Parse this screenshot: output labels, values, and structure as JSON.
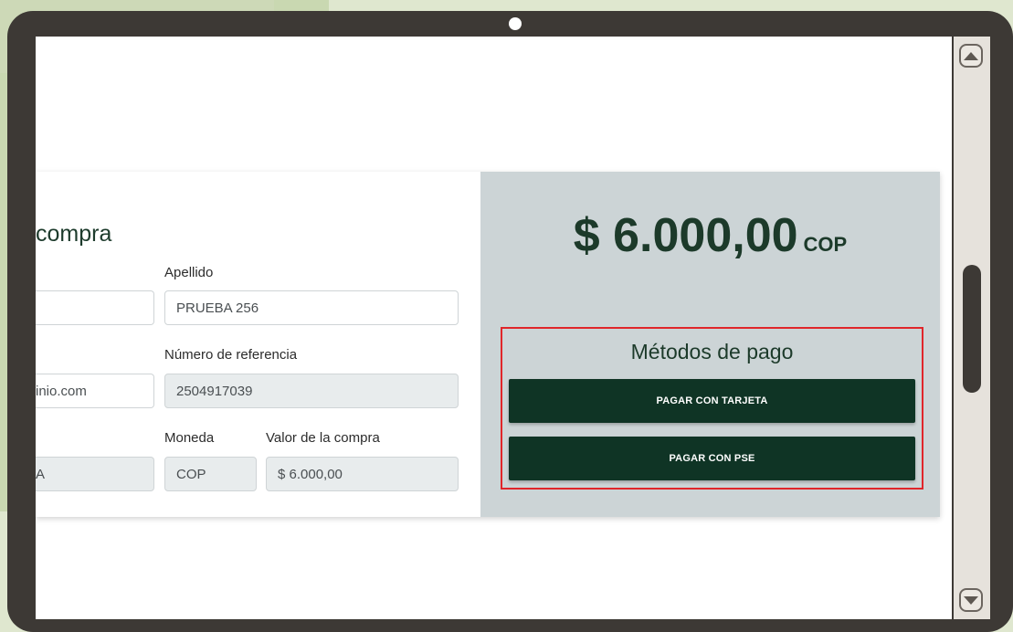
{
  "form": {
    "title": "compra",
    "labels": {
      "apellido": "Apellido",
      "numero_referencia": "Número de referencia",
      "moneda": "Moneda",
      "valor_compra": "Valor de la compra"
    },
    "fields": {
      "nombre": "",
      "apellido": "PRUEBA 256",
      "email": "inio.com",
      "numero_referencia": "2504917039",
      "tipo_documento": "A",
      "moneda": "COP",
      "valor_compra": "$ 6.000,00"
    }
  },
  "summary": {
    "amount": "$ 6.000,00",
    "currency": "COP"
  },
  "payment_methods": {
    "title": "Métodos de pago",
    "card_button": "PAGAR CON TARJETA",
    "pse_button": "PAGAR CON PSE"
  },
  "colors": {
    "accent_dark_green": "#0f3425",
    "highlight_red": "#e0262a",
    "panel_gray": "#ccd4d6"
  }
}
